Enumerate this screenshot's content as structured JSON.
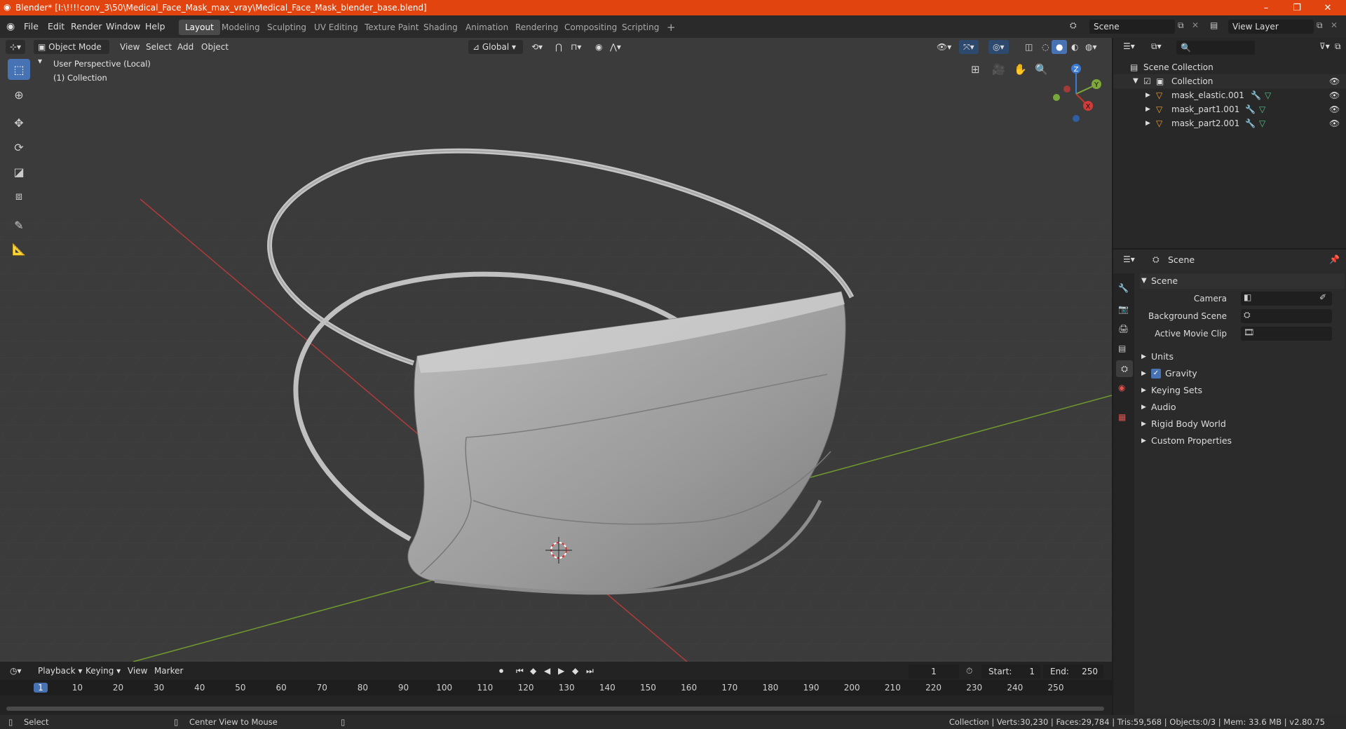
{
  "window": {
    "title": "Blender* [I:\\!!!!conv_3\\50\\Medical_Face_Mask_max_vray\\Medical_Face_Mask_blender_base.blend]",
    "minimize": "–",
    "maximize": "❐",
    "close": "✕"
  },
  "menu": {
    "file": "File",
    "edit": "Edit",
    "render": "Render",
    "window": "Window",
    "help": "Help"
  },
  "workspaces": [
    "Layout",
    "Modeling",
    "Sculpting",
    "UV Editing",
    "Texture Paint",
    "Shading",
    "Animation",
    "Rendering",
    "Compositing",
    "Scripting"
  ],
  "workspace_add": "+",
  "scene_field": "Scene",
  "view_layer_field": "View Layer",
  "viewport": {
    "mode": "Object Mode",
    "view": "View",
    "select": "Select",
    "add": "Add",
    "object": "Object",
    "orientation": "Global",
    "overlay_title": "User Perspective (Local)",
    "overlay_collection": "(1) Collection",
    "gizmo": {
      "z": "Z",
      "y": "Y",
      "x": "X"
    }
  },
  "outliner": {
    "search_placeholder": "",
    "root": "Scene Collection",
    "collection": "Collection",
    "items": [
      {
        "name": "mask_elastic.001"
      },
      {
        "name": "mask_part1.001"
      },
      {
        "name": "mask_part2.001"
      }
    ]
  },
  "properties": {
    "header": "Scene",
    "panel_title": "Scene",
    "camera_label": "Camera",
    "background_label": "Background Scene",
    "movieclip_label": "Active Movie Clip",
    "sections": [
      {
        "label": "Units",
        "checkbox": false
      },
      {
        "label": "Gravity",
        "checkbox": true
      },
      {
        "label": "Keying Sets",
        "checkbox": false
      },
      {
        "label": "Audio",
        "checkbox": false
      },
      {
        "label": "Rigid Body World",
        "checkbox": false
      },
      {
        "label": "Custom Properties",
        "checkbox": false
      }
    ]
  },
  "timeline": {
    "playback": "Playback",
    "keying": "Keying",
    "view": "View",
    "marker": "Marker",
    "current_frame": "1",
    "start_label": "Start:",
    "start_value": "1",
    "end_label": "End:",
    "end_value": "250",
    "ticks": [
      "1",
      "10",
      "20",
      "30",
      "40",
      "50",
      "60",
      "70",
      "80",
      "90",
      "100",
      "110",
      "120",
      "130",
      "140",
      "150",
      "160",
      "170",
      "180",
      "190",
      "200",
      "210",
      "220",
      "230",
      "240",
      "250"
    ]
  },
  "status": {
    "select": "Select",
    "center_view": "Center View to Mouse",
    "stats": "Collection | Verts:30,230 | Faces:29,784 | Tris:59,568 | Objects:0/3 | Mem: 33.6 MB | v2.80.75"
  },
  "colors": {
    "titlebar": "#e1440e",
    "accent": "#4772b3",
    "viewport_bg": "#3b3b3b",
    "axis_x": "#c0392b",
    "axis_y": "#7fa83a"
  }
}
